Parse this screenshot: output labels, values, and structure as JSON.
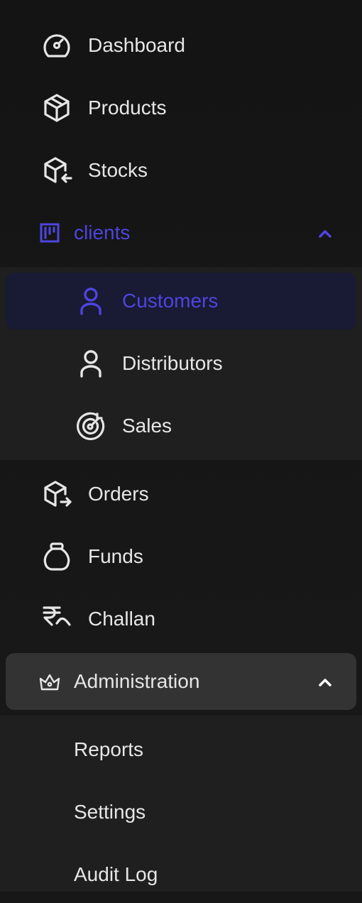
{
  "nav": {
    "dashboard": {
      "label": "Dashboard",
      "icon": "gauge-icon"
    },
    "products": {
      "label": "Products",
      "icon": "box-icon"
    },
    "stocks": {
      "label": "Stocks",
      "icon": "box-arrow-in-icon"
    },
    "clients": {
      "label": "clients",
      "icon": "kanban-icon",
      "expanded": true,
      "items": [
        {
          "label": "Customers",
          "icon": "user-icon",
          "active": true
        },
        {
          "label": "Distributors",
          "icon": "user-icon"
        },
        {
          "label": "Sales",
          "icon": "target-icon"
        }
      ]
    },
    "orders": {
      "label": "Orders",
      "icon": "box-arrow-out-icon"
    },
    "funds": {
      "label": "Funds",
      "icon": "money-bag-icon"
    },
    "challan": {
      "label": "Challan",
      "icon": "rupee-icon"
    },
    "administration": {
      "label": "Administration",
      "icon": "crown-icon",
      "expanded": true,
      "items": [
        {
          "label": "Reports"
        },
        {
          "label": "Settings"
        },
        {
          "label": "Audit Log"
        }
      ]
    }
  },
  "colors": {
    "background": "#171717",
    "submenu_background": "#1f1f1f",
    "text": "#e6e6e6",
    "accent": "#4d45e0",
    "active_background": "#191a33",
    "admin_background": "#333333"
  }
}
